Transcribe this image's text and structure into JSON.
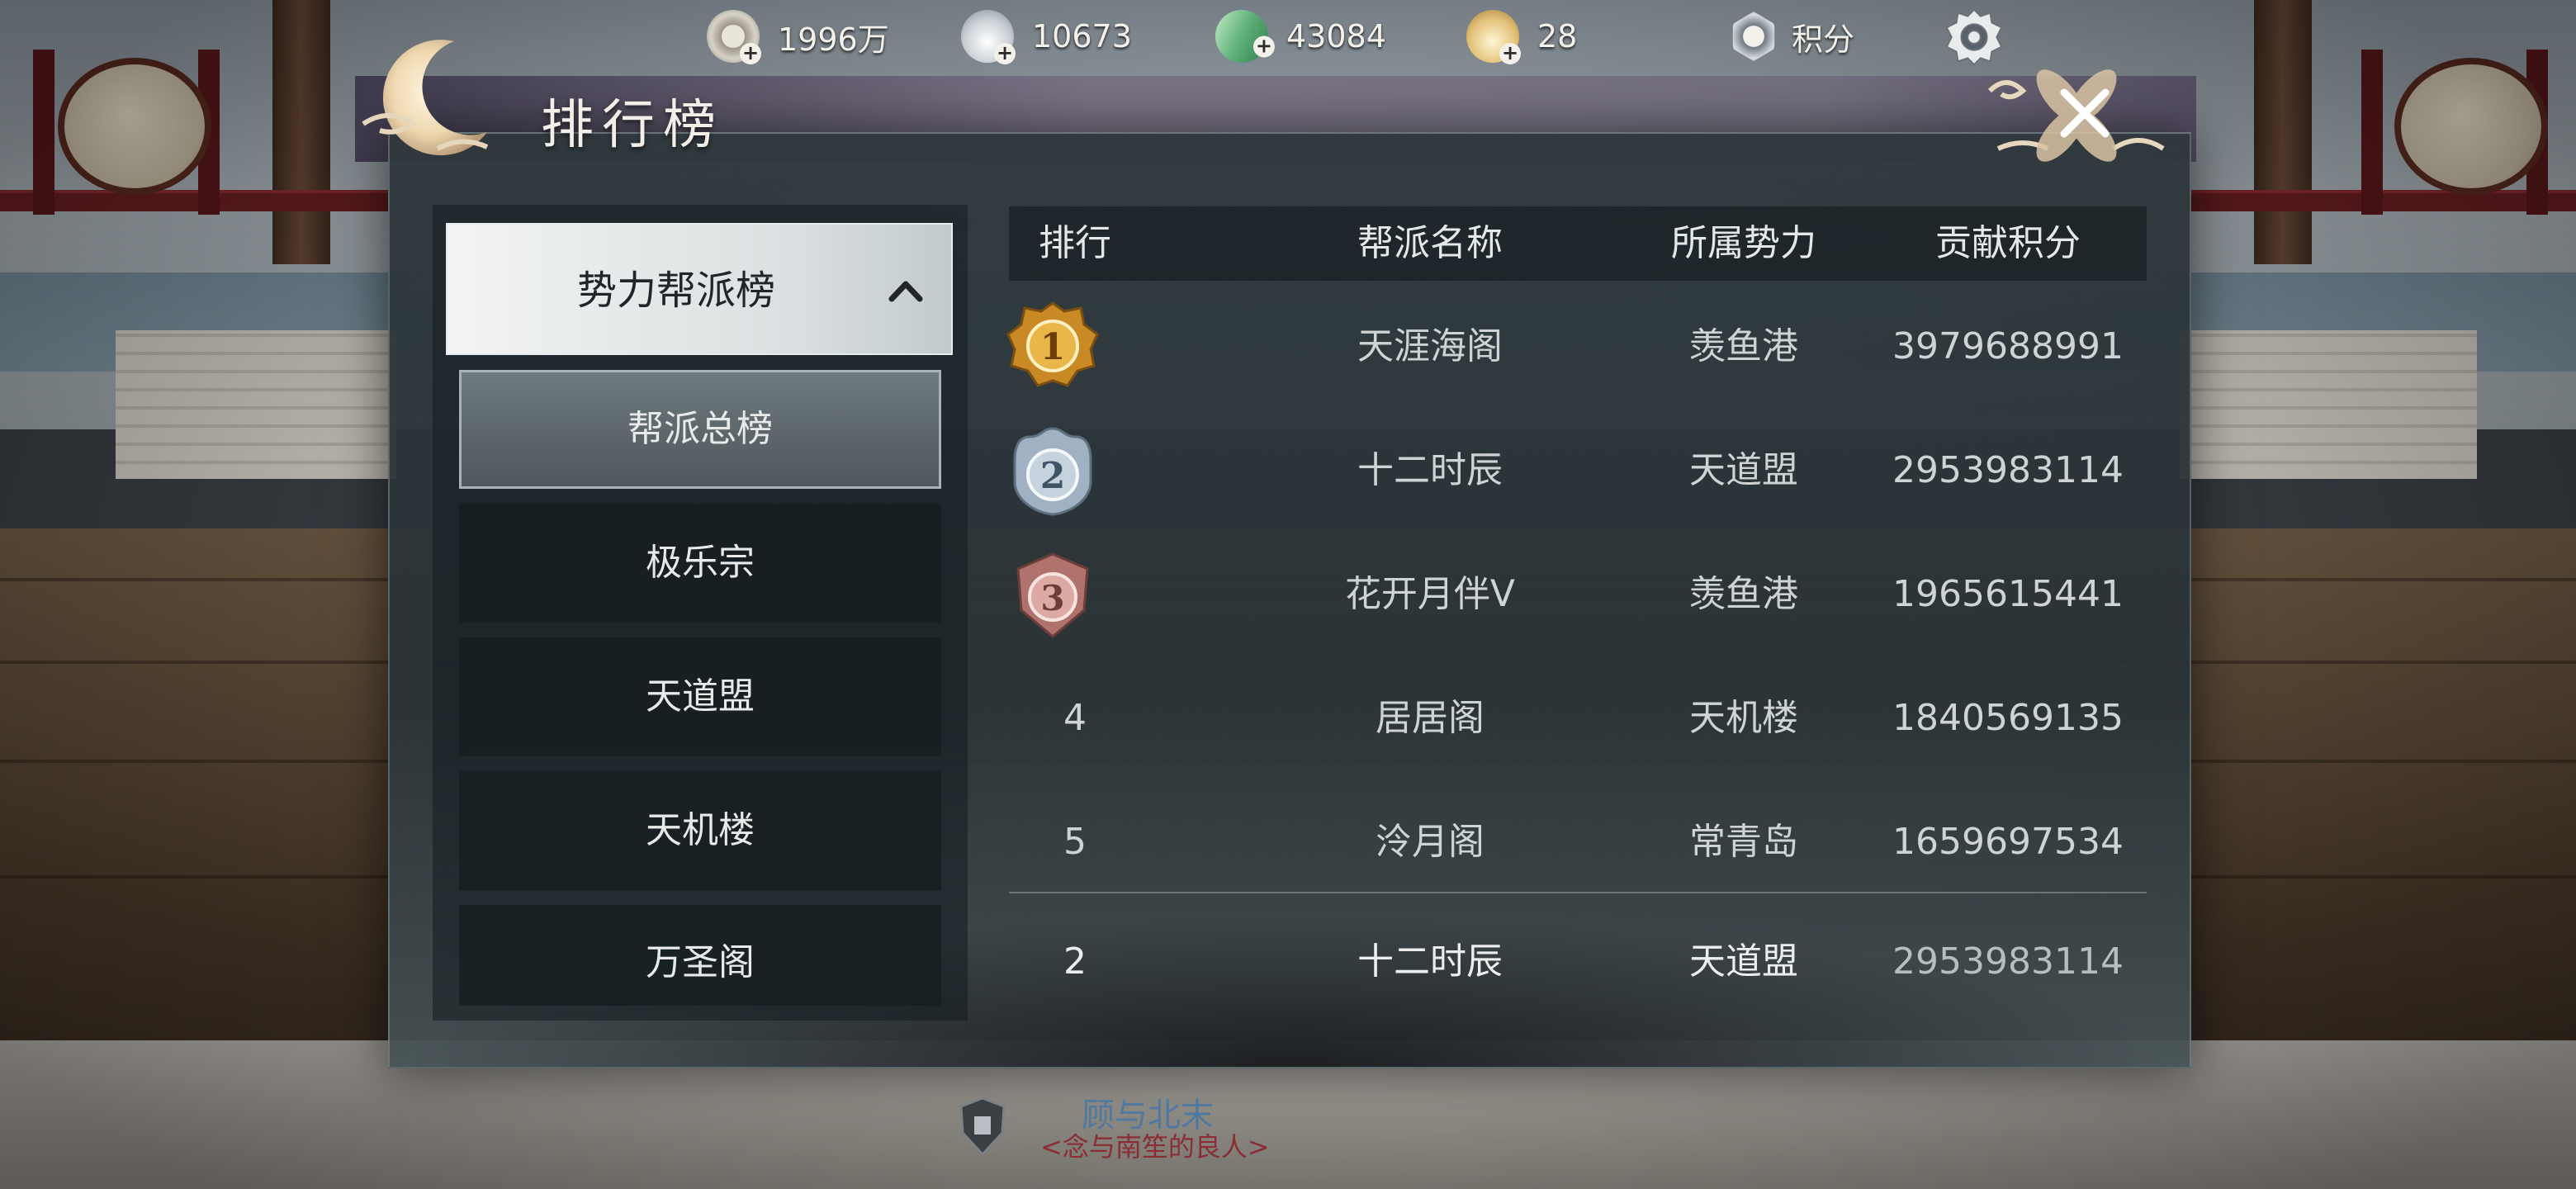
{
  "currency": {
    "coin": {
      "value": "1996万",
      "icon": "coin-reel-icon"
    },
    "silver": {
      "value": "10673",
      "icon": "silver-ingot-icon"
    },
    "jade": {
      "value": "43084",
      "icon": "jade-icon"
    },
    "gold": {
      "value": "28",
      "icon": "gold-ingot-icon"
    },
    "score_label": "积分",
    "settings_icon": "gear-icon"
  },
  "window": {
    "title": "排行榜"
  },
  "sidebar": {
    "category": "势力帮派榜",
    "items": [
      {
        "label": "帮派总榜",
        "active": true
      },
      {
        "label": "极乐宗",
        "active": false
      },
      {
        "label": "天道盟",
        "active": false
      },
      {
        "label": "天机楼",
        "active": false
      },
      {
        "label": "万圣阁",
        "active": false
      }
    ]
  },
  "table": {
    "headers": [
      "排行",
      "帮派名称",
      "所属势力",
      "贡献积分"
    ],
    "rows": [
      {
        "rank": "1",
        "name": "天涯海阁",
        "faction": "羡鱼港",
        "score": "3979688991",
        "medal": "gold"
      },
      {
        "rank": "2",
        "name": "十二时辰",
        "faction": "天道盟",
        "score": "2953983114",
        "medal": "silver"
      },
      {
        "rank": "3",
        "name": "花开月伴ᐯ",
        "faction": "羡鱼港",
        "score": "1965615441",
        "medal": "bronze"
      },
      {
        "rank": "4",
        "name": "居居阁",
        "faction": "天机楼",
        "score": "1840569135",
        "medal": ""
      },
      {
        "rank": "5",
        "name": "泠月阁",
        "faction": "常青岛",
        "score": "1659697534",
        "medal": ""
      }
    ],
    "my_row": {
      "rank": "2",
      "name": "十二时辰",
      "faction": "天道盟",
      "score": "2953983114"
    }
  },
  "player_tag": {
    "name": "顾与北末",
    "title": "<念与南笙的良人>"
  },
  "colors": {
    "medal_gold": "#d9a43a",
    "medal_silver": "#a9b8c6",
    "medal_bronze": "#c98a86",
    "active_tab": "#5f6a6e"
  }
}
